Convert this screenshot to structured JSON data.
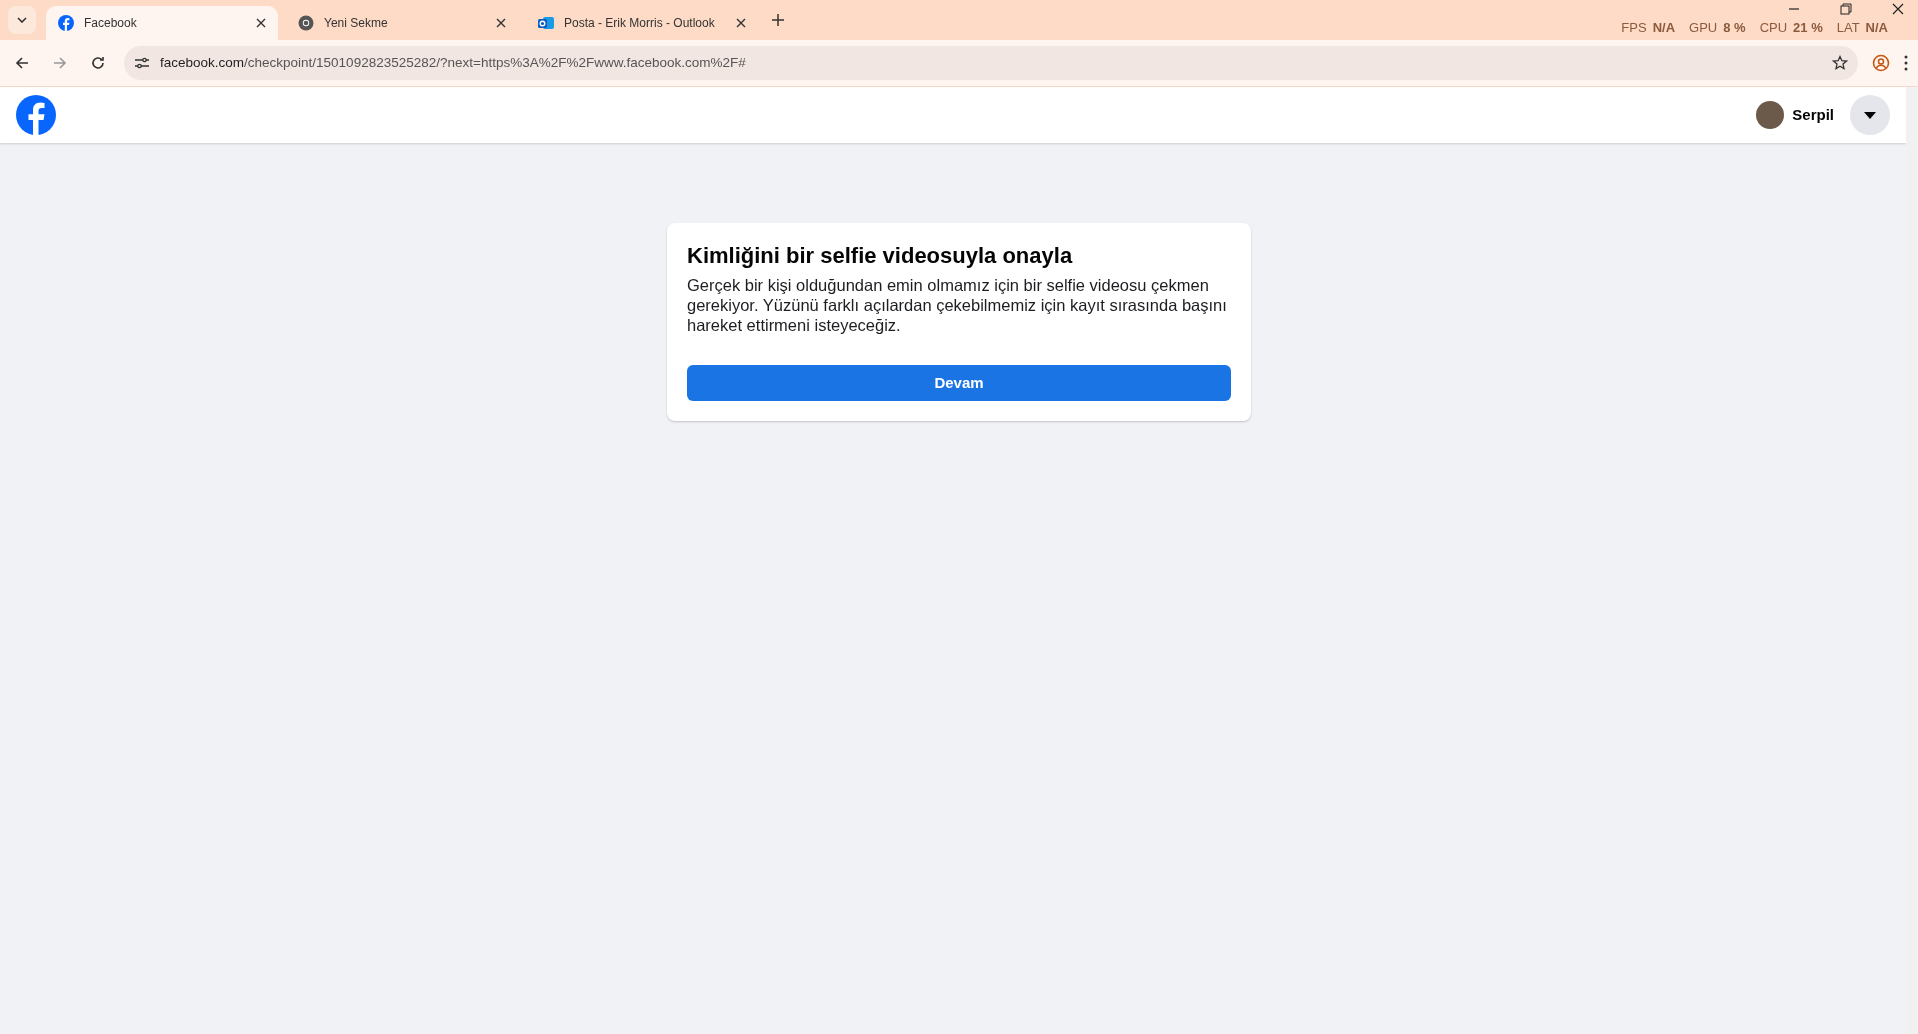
{
  "browser": {
    "tabs": [
      {
        "title": "Facebook",
        "selected": true
      },
      {
        "title": "Yeni Sekme",
        "selected": false
      },
      {
        "title": "Posta - Erik Morris - Outlook",
        "selected": false
      }
    ],
    "overlay_stats": [
      {
        "label": "FPS",
        "value": "N/A"
      },
      {
        "label": "GPU",
        "value": "8 %"
      },
      {
        "label": "CPU",
        "value": "21 %"
      },
      {
        "label": "LAT",
        "value": "N/A"
      }
    ],
    "address": "facebook.com/checkpoint/1501092823525282/?next=https%3A%2F%2Fwww.facebook.com%2F#"
  },
  "header": {
    "user_name": "Serpil"
  },
  "card": {
    "title": "Kimliğini bir selfie videosuyla onayla",
    "body": "Gerçek bir kişi olduğundan emin olmamız için bir selfie videosu çekmen gerekiyor. Yüzünü farklı açılardan çekebilmemiz için kayıt sırasında başını hareket ettirmeni isteyeceğiz.",
    "button": "Devam"
  }
}
